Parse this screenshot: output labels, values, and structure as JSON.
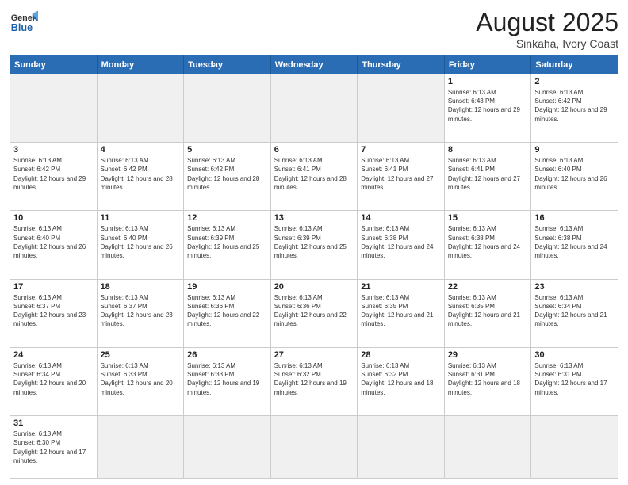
{
  "header": {
    "logo_general": "General",
    "logo_blue": "Blue",
    "title": "August 2025",
    "location": "Sinkaha, Ivory Coast"
  },
  "weekdays": [
    "Sunday",
    "Monday",
    "Tuesday",
    "Wednesday",
    "Thursday",
    "Friday",
    "Saturday"
  ],
  "weeks": [
    [
      {
        "day": "",
        "empty": true
      },
      {
        "day": "",
        "empty": true
      },
      {
        "day": "",
        "empty": true
      },
      {
        "day": "",
        "empty": true
      },
      {
        "day": "",
        "empty": true
      },
      {
        "day": "1",
        "sunrise": "6:13 AM",
        "sunset": "6:43 PM",
        "daylight": "12 hours and 29 minutes."
      },
      {
        "day": "2",
        "sunrise": "6:13 AM",
        "sunset": "6:42 PM",
        "daylight": "12 hours and 29 minutes."
      }
    ],
    [
      {
        "day": "3",
        "sunrise": "6:13 AM",
        "sunset": "6:42 PM",
        "daylight": "12 hours and 29 minutes."
      },
      {
        "day": "4",
        "sunrise": "6:13 AM",
        "sunset": "6:42 PM",
        "daylight": "12 hours and 28 minutes."
      },
      {
        "day": "5",
        "sunrise": "6:13 AM",
        "sunset": "6:42 PM",
        "daylight": "12 hours and 28 minutes."
      },
      {
        "day": "6",
        "sunrise": "6:13 AM",
        "sunset": "6:41 PM",
        "daylight": "12 hours and 28 minutes."
      },
      {
        "day": "7",
        "sunrise": "6:13 AM",
        "sunset": "6:41 PM",
        "daylight": "12 hours and 27 minutes."
      },
      {
        "day": "8",
        "sunrise": "6:13 AM",
        "sunset": "6:41 PM",
        "daylight": "12 hours and 27 minutes."
      },
      {
        "day": "9",
        "sunrise": "6:13 AM",
        "sunset": "6:40 PM",
        "daylight": "12 hours and 26 minutes."
      }
    ],
    [
      {
        "day": "10",
        "sunrise": "6:13 AM",
        "sunset": "6:40 PM",
        "daylight": "12 hours and 26 minutes."
      },
      {
        "day": "11",
        "sunrise": "6:13 AM",
        "sunset": "6:40 PM",
        "daylight": "12 hours and 26 minutes."
      },
      {
        "day": "12",
        "sunrise": "6:13 AM",
        "sunset": "6:39 PM",
        "daylight": "12 hours and 25 minutes."
      },
      {
        "day": "13",
        "sunrise": "6:13 AM",
        "sunset": "6:39 PM",
        "daylight": "12 hours and 25 minutes."
      },
      {
        "day": "14",
        "sunrise": "6:13 AM",
        "sunset": "6:38 PM",
        "daylight": "12 hours and 24 minutes."
      },
      {
        "day": "15",
        "sunrise": "6:13 AM",
        "sunset": "6:38 PM",
        "daylight": "12 hours and 24 minutes."
      },
      {
        "day": "16",
        "sunrise": "6:13 AM",
        "sunset": "6:38 PM",
        "daylight": "12 hours and 24 minutes."
      }
    ],
    [
      {
        "day": "17",
        "sunrise": "6:13 AM",
        "sunset": "6:37 PM",
        "daylight": "12 hours and 23 minutes."
      },
      {
        "day": "18",
        "sunrise": "6:13 AM",
        "sunset": "6:37 PM",
        "daylight": "12 hours and 23 minutes."
      },
      {
        "day": "19",
        "sunrise": "6:13 AM",
        "sunset": "6:36 PM",
        "daylight": "12 hours and 22 minutes."
      },
      {
        "day": "20",
        "sunrise": "6:13 AM",
        "sunset": "6:36 PM",
        "daylight": "12 hours and 22 minutes."
      },
      {
        "day": "21",
        "sunrise": "6:13 AM",
        "sunset": "6:35 PM",
        "daylight": "12 hours and 21 minutes."
      },
      {
        "day": "22",
        "sunrise": "6:13 AM",
        "sunset": "6:35 PM",
        "daylight": "12 hours and 21 minutes."
      },
      {
        "day": "23",
        "sunrise": "6:13 AM",
        "sunset": "6:34 PM",
        "daylight": "12 hours and 21 minutes."
      }
    ],
    [
      {
        "day": "24",
        "sunrise": "6:13 AM",
        "sunset": "6:34 PM",
        "daylight": "12 hours and 20 minutes."
      },
      {
        "day": "25",
        "sunrise": "6:13 AM",
        "sunset": "6:33 PM",
        "daylight": "12 hours and 20 minutes."
      },
      {
        "day": "26",
        "sunrise": "6:13 AM",
        "sunset": "6:33 PM",
        "daylight": "12 hours and 19 minutes."
      },
      {
        "day": "27",
        "sunrise": "6:13 AM",
        "sunset": "6:32 PM",
        "daylight": "12 hours and 19 minutes."
      },
      {
        "day": "28",
        "sunrise": "6:13 AM",
        "sunset": "6:32 PM",
        "daylight": "12 hours and 18 minutes."
      },
      {
        "day": "29",
        "sunrise": "6:13 AM",
        "sunset": "6:31 PM",
        "daylight": "12 hours and 18 minutes."
      },
      {
        "day": "30",
        "sunrise": "6:13 AM",
        "sunset": "6:31 PM",
        "daylight": "12 hours and 17 minutes."
      }
    ],
    [
      {
        "day": "31",
        "sunrise": "6:13 AM",
        "sunset": "6:30 PM",
        "daylight": "12 hours and 17 minutes.",
        "last": true
      },
      {
        "day": "",
        "empty": true,
        "last": true
      },
      {
        "day": "",
        "empty": true,
        "last": true
      },
      {
        "day": "",
        "empty": true,
        "last": true
      },
      {
        "day": "",
        "empty": true,
        "last": true
      },
      {
        "day": "",
        "empty": true,
        "last": true
      },
      {
        "day": "",
        "empty": true,
        "last": true
      }
    ]
  ]
}
